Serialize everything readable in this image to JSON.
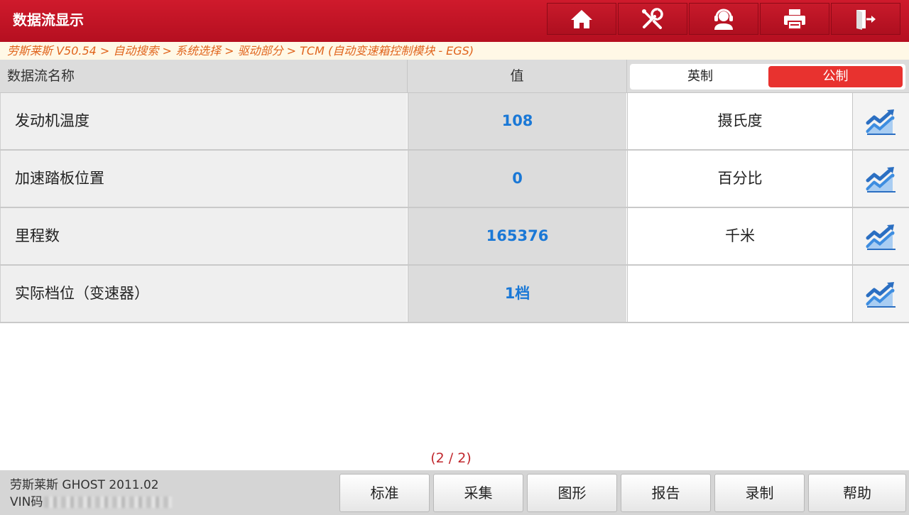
{
  "header": {
    "title": "数据流显示",
    "toolbar": [
      {
        "name": "home-icon"
      },
      {
        "name": "diagnostic-tool-icon"
      },
      {
        "name": "support-icon"
      },
      {
        "name": "printer-icon"
      },
      {
        "name": "exit-icon"
      }
    ]
  },
  "breadcrumb": "劳斯莱斯 V50.54 > 自动搜索 > 系统选择 > 驱动部分 > TCM (自动变速箱控制模块 - EGS)",
  "table": {
    "col_name": "数据流名称",
    "col_value": "值",
    "unit_imperial": "英制",
    "unit_metric": "公制",
    "selected_unit": "公制",
    "rows": [
      {
        "name": "发动机温度",
        "value": "108",
        "unit": "摄氏度"
      },
      {
        "name": "加速踏板位置",
        "value": "0",
        "unit": "百分比"
      },
      {
        "name": "里程数",
        "value": "165376",
        "unit": "千米"
      },
      {
        "name": "实际档位（变速器）",
        "value": "1档",
        "unit": ""
      }
    ]
  },
  "page_indicator": "(2 / 2)",
  "footer": {
    "vehicle": "劳斯莱斯 GHOST 2011.02",
    "vin_label": "VIN码",
    "buttons": [
      "标准",
      "采集",
      "图形",
      "报告",
      "录制",
      "帮助"
    ]
  },
  "colors": {
    "header_red": "#c41526",
    "breadcrumb_orange": "#e0641c",
    "value_blue": "#1a78d6",
    "metric_active": "#e8322f",
    "page_indicator": "#c0272d"
  }
}
